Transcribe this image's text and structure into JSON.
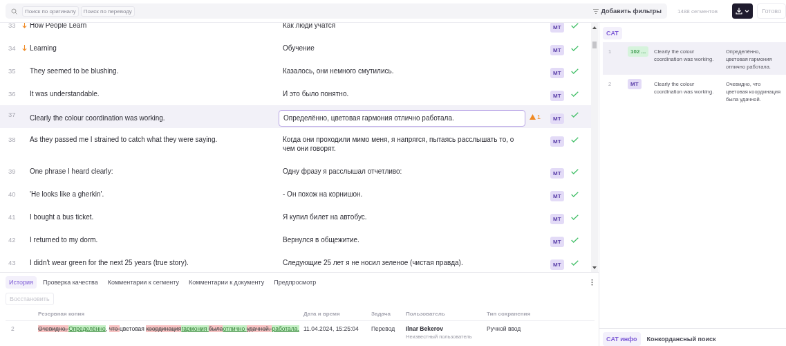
{
  "toolbar": {
    "search_chips": [
      "Поиск по оригиналу",
      "Поиск по переводу"
    ],
    "filter_button": "Добавить фильтры",
    "segment_count": "1488 сегментов",
    "done_button": "Готово"
  },
  "segments": [
    {
      "number": "33",
      "arrow": true,
      "source": "How People Learn",
      "target": "Как люди учатся",
      "badge": "MT",
      "confirmed": true,
      "selected": false
    },
    {
      "number": "34",
      "arrow": true,
      "source": "Learning",
      "target": "Обучение",
      "badge": "MT",
      "confirmed": true,
      "selected": false
    },
    {
      "number": "35",
      "arrow": false,
      "source": "They seemed to be blushing.",
      "target": "Казалось, они немного смутились.",
      "badge": "MT",
      "confirmed": true,
      "selected": false
    },
    {
      "number": "36",
      "arrow": false,
      "source": "It was understandable.",
      "target": "И это было понятно.",
      "badge": "MT",
      "confirmed": true,
      "selected": false
    },
    {
      "number": "37",
      "arrow": false,
      "source": "Clearly the colour coordination was working.",
      "target": "Определённо, цветовая гармония отлично работала.",
      "warnings": "1",
      "badge": "MT",
      "confirmed": true,
      "selected": true
    },
    {
      "number": "38",
      "arrow": false,
      "source": "As they passed me I strained to catch what they were saying.",
      "target": "Когда они проходили мимо меня, я напрягся, пытаясь расслышать то, о чем они говорят.",
      "badge": "MT",
      "confirmed": true,
      "selected": false
    },
    {
      "number": "39",
      "arrow": false,
      "source": "One phrase I heard clearly:",
      "target": "Одну фразу я расслышал отчетливо:",
      "badge": "MT",
      "confirmed": true,
      "selected": false
    },
    {
      "number": "40",
      "arrow": false,
      "source": "'He looks like a gherkin'.",
      "target": "- Он похож на корнишон.",
      "badge": "MT",
      "confirmed": true,
      "selected": false
    },
    {
      "number": "41",
      "arrow": false,
      "source": "I bought a bus ticket.",
      "target": "Я купил билет на автобус.",
      "badge": "MT",
      "confirmed": true,
      "selected": false
    },
    {
      "number": "42",
      "arrow": false,
      "source": "I returned to my dorm.",
      "target": "Вернулся в общежитие.",
      "badge": "MT",
      "confirmed": true,
      "selected": false
    },
    {
      "number": "43",
      "arrow": false,
      "source": "I didn't wear green for the next 25 years (true story).",
      "target": "Следующие 25 лет я не носил зеленое (чистая правда).",
      "badge": "MT",
      "confirmed": true,
      "selected": false
    }
  ],
  "bottom_panel": {
    "tabs": [
      {
        "label": "История",
        "selected": true
      },
      {
        "label": "Проверка качества",
        "selected": false
      },
      {
        "label": "Комментарии к сегменту",
        "selected": false
      },
      {
        "label": "Комментарии к документу",
        "selected": false
      },
      {
        "label": "Предпросмотр",
        "selected": false
      }
    ],
    "restore_button": {
      "label": "Восстановить",
      "disabled": true
    },
    "columns": [
      "Резервная копия",
      "Дата и время",
      "Задача",
      "Пользователь",
      "Тип сохранения"
    ],
    "rows": [
      {
        "number": "2",
        "diff": [
          {
            "kind": "del",
            "text": "Очевидно, "
          },
          {
            "kind": "ins",
            "text": "Определённо"
          },
          {
            "kind": "same",
            "text": ", "
          },
          {
            "kind": "del",
            "text": "что "
          },
          {
            "kind": "same",
            "text": "цветовая "
          },
          {
            "kind": "del",
            "text": "координация"
          },
          {
            "kind": "ins",
            "text": "гармония "
          },
          {
            "kind": "del",
            "text": "была"
          },
          {
            "kind": "ins",
            "text": "отлично "
          },
          {
            "kind": "del",
            "text": "удачной. "
          },
          {
            "kind": "ins",
            "text": "работала."
          }
        ],
        "date": "11.04.2024, 15:25:04",
        "task": "Перевод",
        "user": "Ilnar Bekerov",
        "user_role": "Неизвестный пользователь",
        "save_type": "Ручной ввод"
      }
    ]
  },
  "cat_panel": {
    "tabs": [
      {
        "label": "CAT",
        "selected": true
      }
    ],
    "matches": [
      {
        "number": "1",
        "kind": "match",
        "badge": "102 ...",
        "source": "Clearly the colour coordination was working.",
        "target": "Определённо, цветовая гармония отлично работала.",
        "selected": true
      },
      {
        "number": "2",
        "kind": "mt",
        "badge": "MT",
        "source": "Clearly the colour coordination was working.",
        "target": "Очевидно, что цветовая координация была удачной.",
        "selected": false
      }
    ],
    "bottom_tabs": [
      {
        "label": "CAT инфо",
        "selected": true
      },
      {
        "label": "Конкордансный поиск",
        "selected": false
      }
    ]
  }
}
